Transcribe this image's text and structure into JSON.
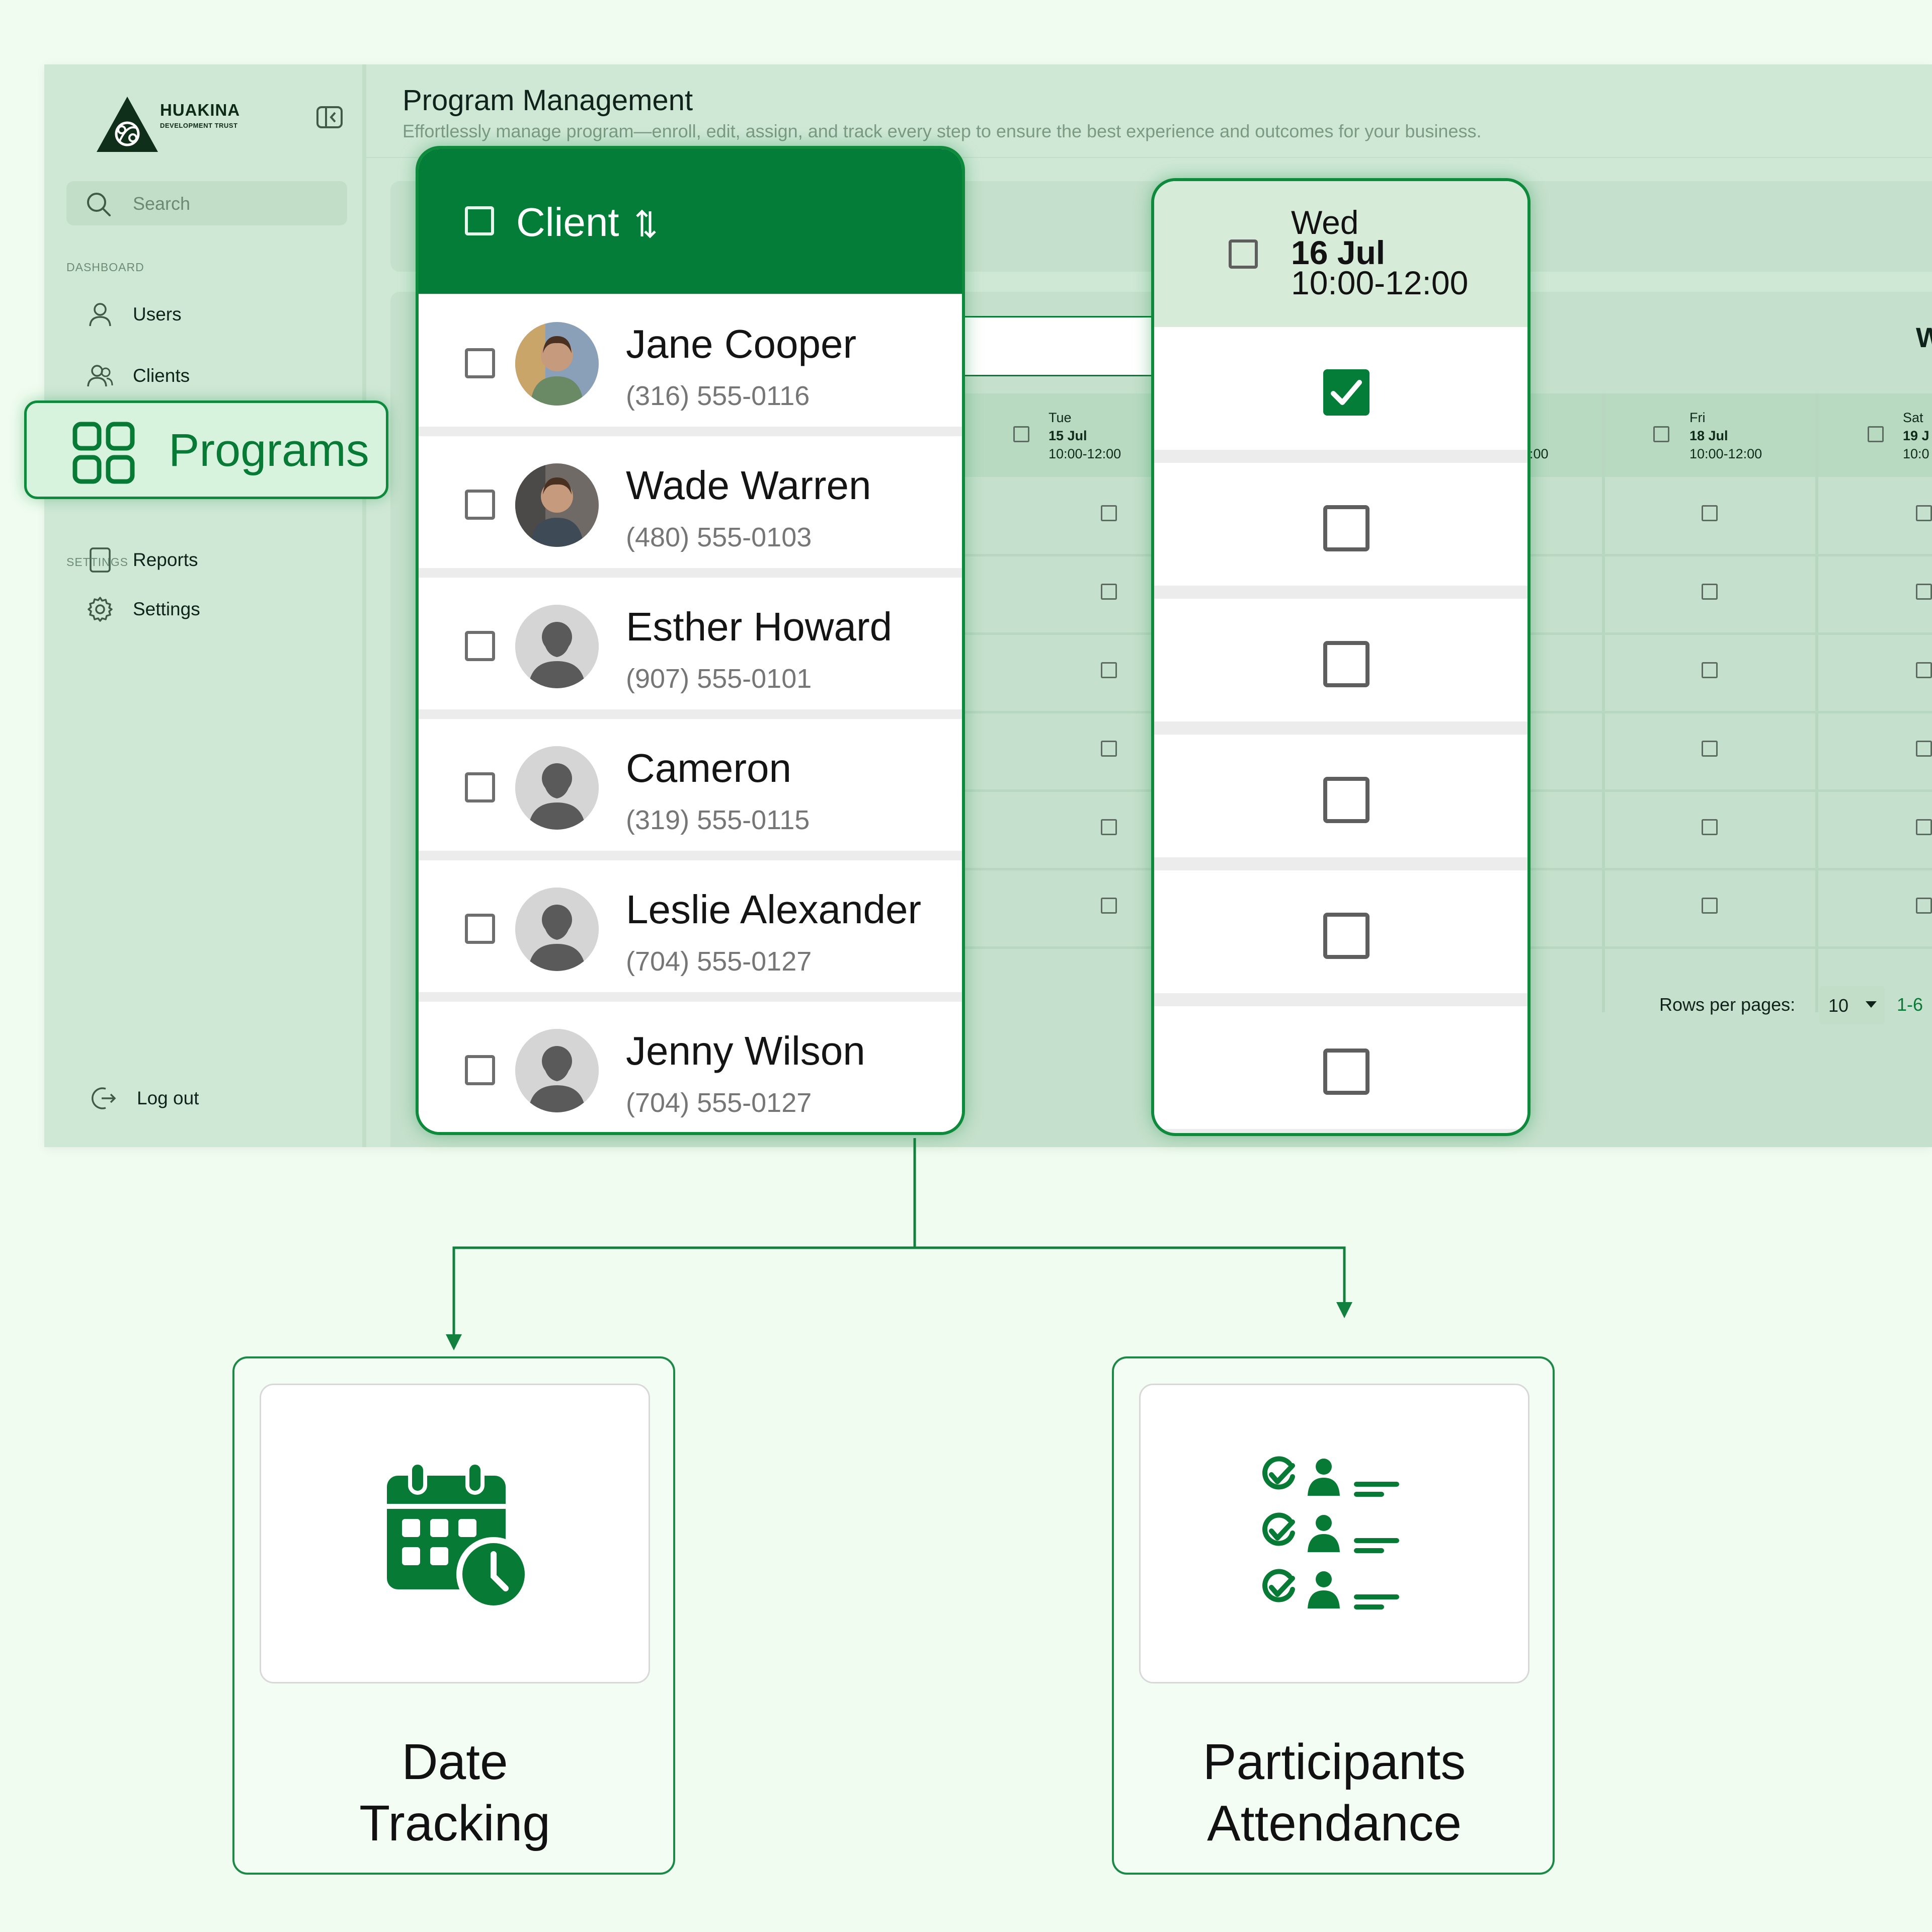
{
  "brand": {
    "name": "HUAKINA",
    "subtitle": "DEVELOPMENT TRUST",
    "primary_color": "#047d38",
    "background_color": "#effcef",
    "sidebar_color": "#cfe8d6"
  },
  "sidebar": {
    "search_placeholder": "Search",
    "dashboard_label": "DASHBOARD",
    "settings_label": "SETTINGS",
    "items": [
      {
        "label": "Users",
        "icon": "user-icon"
      },
      {
        "label": "Clients",
        "icon": "users-icon"
      },
      {
        "label": "Reports",
        "icon": "report-icon"
      },
      {
        "label": "Settings",
        "icon": "gear-icon"
      }
    ],
    "logout_label": "Log out",
    "highlight": {
      "label": "Programs",
      "icon": "grid-icon"
    }
  },
  "header": {
    "title": "Program Management",
    "subtitle": "Effortlessly manage program—enroll, edit, assign, and track every step to ensure the best experience and outcomes for your business."
  },
  "schedule": {
    "days": [
      {
        "day": "Tue",
        "date": "15 Jul",
        "time": "10:00-12:00"
      },
      {
        "day": "Fri",
        "date": "18 Jul",
        "time": "10:00-12:00"
      },
      {
        "day": "Sat",
        "date": "19 J",
        "time": "10:0"
      }
    ],
    "partial_time": ":00",
    "partial_heading": "W",
    "row_count": 6,
    "rows_per_page_label": "Rows per pages:",
    "rows_per_page_value": "10",
    "page_range": "1-6"
  },
  "client_card": {
    "header": "Client",
    "clients": [
      {
        "name": "Jane Cooper",
        "phone": "(316) 555-0116",
        "avatar": "photo"
      },
      {
        "name": "Wade Warren",
        "phone": "(480) 555-0103",
        "avatar": "photo"
      },
      {
        "name": "Esther Howard",
        "phone": "(907) 555-0101",
        "avatar": "placeholder"
      },
      {
        "name": "Cameron",
        "phone": "(319) 555-0115",
        "avatar": "placeholder"
      },
      {
        "name": "Leslie Alexander",
        "phone": "(704) 555-0127",
        "avatar": "placeholder"
      },
      {
        "name": "Jenny Wilson",
        "phone": "(704) 555-0127",
        "avatar": "placeholder"
      }
    ]
  },
  "wed_card": {
    "day": "Wed",
    "date": "16 Jul",
    "time": "10:00-12:00",
    "attendance": [
      true,
      false,
      false,
      false,
      false,
      false
    ]
  },
  "features": [
    {
      "title_line1": "Date",
      "title_line2": "Tracking",
      "icon": "calendar-clock-icon"
    },
    {
      "title_line1": "Participants",
      "title_line2": "Attendance",
      "icon": "attendance-list-icon"
    }
  ]
}
